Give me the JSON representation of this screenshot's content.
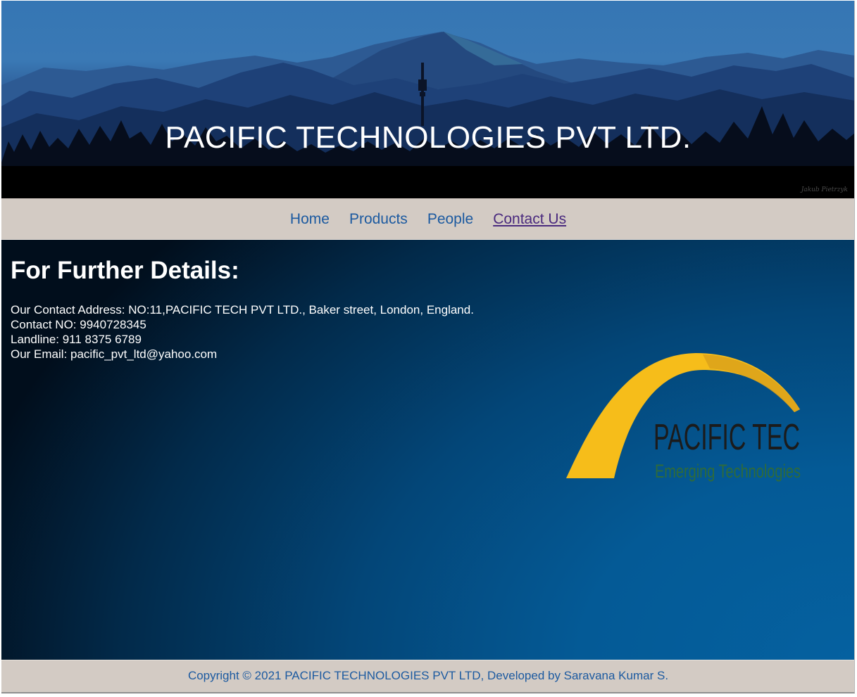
{
  "header": {
    "title": "PACIFIC TECHNOLOGIES PVT LTD.",
    "signature": "Jakub Pietrzyk"
  },
  "nav": {
    "items": [
      {
        "label": "Home",
        "active": false
      },
      {
        "label": "Products",
        "active": false
      },
      {
        "label": "People",
        "active": false
      },
      {
        "label": "Contact Us",
        "active": true
      }
    ]
  },
  "main": {
    "heading": "For Further Details:",
    "address": "Our Contact Address: NO:11,PACIFIC TECH PVT LTD., Baker street, London, England.",
    "contact_no": "Contact NO: 9940728345",
    "landline": "Landline: 911 8375 6789",
    "email": "Our Email: pacific_pvt_ltd@yahoo.com",
    "logo": {
      "name": "PACIFIC TEC",
      "tagline": "Emerging Technologies"
    }
  },
  "footer": {
    "copyright": "Copyright © 2021 PACIFIC TECHNOLOGIES PVT LTD, Developed by Saravana Kumar S."
  },
  "colors": {
    "nav_bg": "#d3cbc4",
    "link": "#1c5aa0",
    "active_link": "#4a2a7e",
    "content_bg": "#0561a0",
    "logo_arc": "#f6bd1a",
    "logo_text": "#1b1b1b",
    "logo_tagline": "#2f6b3a"
  }
}
